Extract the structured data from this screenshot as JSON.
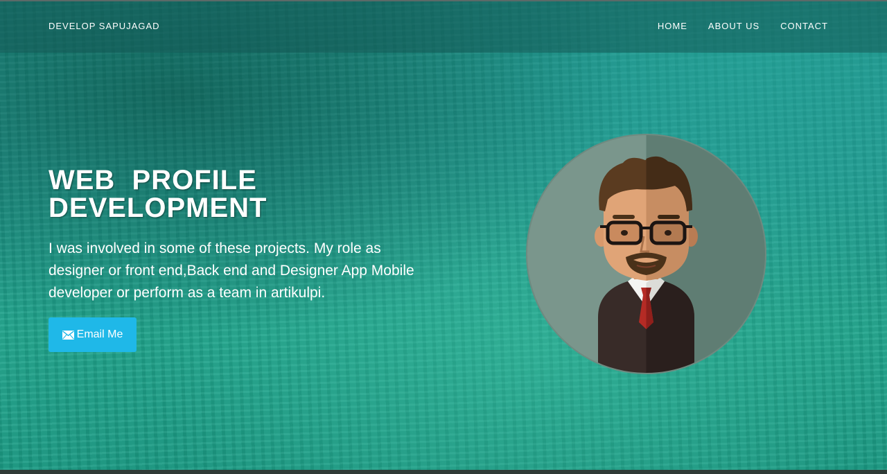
{
  "navbar": {
    "brand": "DEVELOP SAPUJAGAD",
    "links": [
      {
        "label": "HOME"
      },
      {
        "label": "ABOUT US"
      },
      {
        "label": "CONTACT"
      }
    ]
  },
  "hero": {
    "title_line1": "WEB  PROFILE",
    "title_line2": "DEVELOPMENT",
    "description": "I was involved in some of these projects. My role as designer or front end,Back end and Designer App Mobile developer or perform as a team in artikulpi.",
    "button_label": "Email Me",
    "button_icon": "envelope-icon",
    "avatar_icon": "developer-avatar-icon"
  },
  "colors": {
    "accent_button": "#1fb8e8",
    "hero_overlay": "#16a085",
    "text": "#ffffff"
  }
}
